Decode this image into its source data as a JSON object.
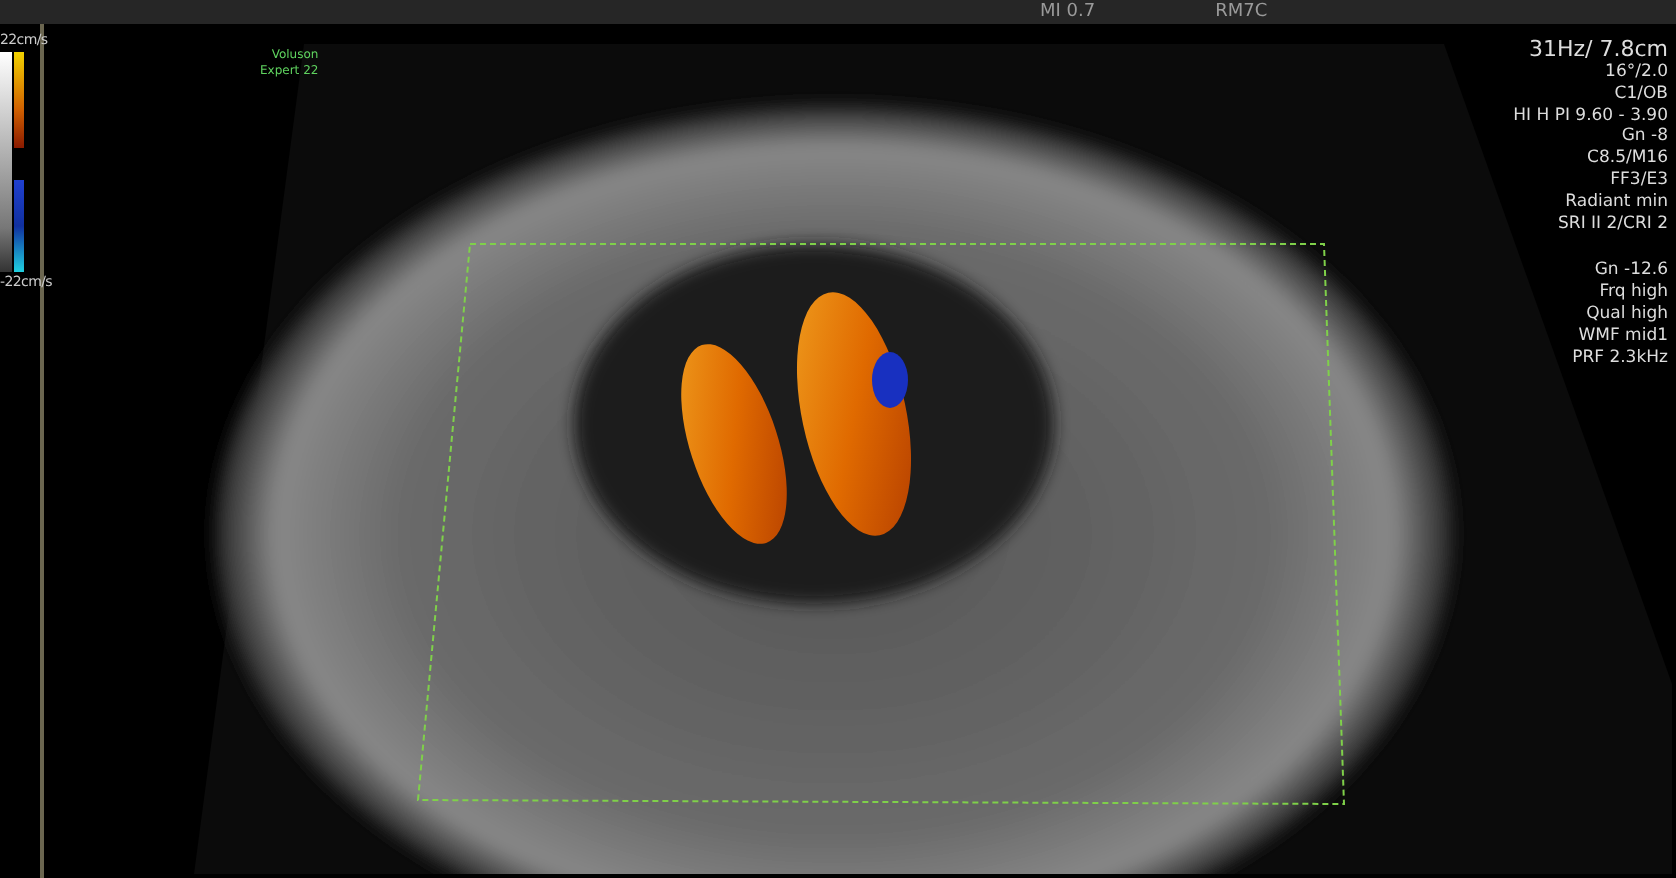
{
  "header": {
    "mechanical_index": "MI 0.7",
    "probe": "RM7C"
  },
  "color_scale": {
    "top": "22cm/s",
    "bottom": "-22cm/s"
  },
  "system_label": [
    "Voluson",
    "Expert 22"
  ],
  "image_parameters": [
    "31Hz/ 7.8cm",
    "16°/2.0",
    "C1/OB",
    "HI H PI 9.60 - 3.90",
    "Gn  -8",
    "C8.5/M16",
    "FF3/E3",
    "Radiant min",
    "SRI II 2/CRI 2"
  ],
  "color_parameters": [
    "Gn -12.6",
    "Frq high",
    "Qual high",
    "WMF mid1",
    "PRF  2.3kHz"
  ]
}
